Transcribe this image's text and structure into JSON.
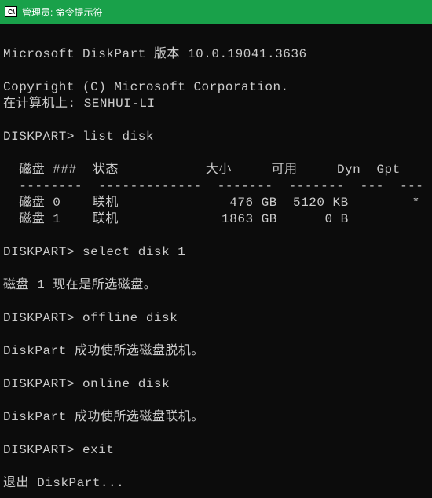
{
  "window": {
    "icon_text": "C:\\",
    "title": "管理员: 命令提示符"
  },
  "lines": {
    "l0": "",
    "l1": "Microsoft DiskPart 版本 10.0.19041.3636",
    "l2": "",
    "l3": "Copyright (C) Microsoft Corporation.",
    "l4": "在计算机上: SENHUI-LI",
    "l5": "",
    "l6": "DISKPART> list disk",
    "l7": "",
    "l8": "  磁盘 ###  状态           大小     可用     Dyn  Gpt",
    "l9": "  --------  -------------  -------  -------  ---  ---",
    "l10": "  磁盘 0    联机              476 GB  5120 KB        *",
    "l11": "  磁盘 1    联机             1863 GB      0 B",
    "l12": "",
    "l13": "DISKPART> select disk 1",
    "l14": "",
    "l15": "磁盘 1 现在是所选磁盘。",
    "l16": "",
    "l17": "DISKPART> offline disk",
    "l18": "",
    "l19": "DiskPart 成功使所选磁盘脱机。",
    "l20": "",
    "l21": "DISKPART> online disk",
    "l22": "",
    "l23": "DiskPart 成功使所选磁盘联机。",
    "l24": "",
    "l25": "DISKPART> exit",
    "l26": "",
    "l27": "退出 DiskPart..."
  }
}
